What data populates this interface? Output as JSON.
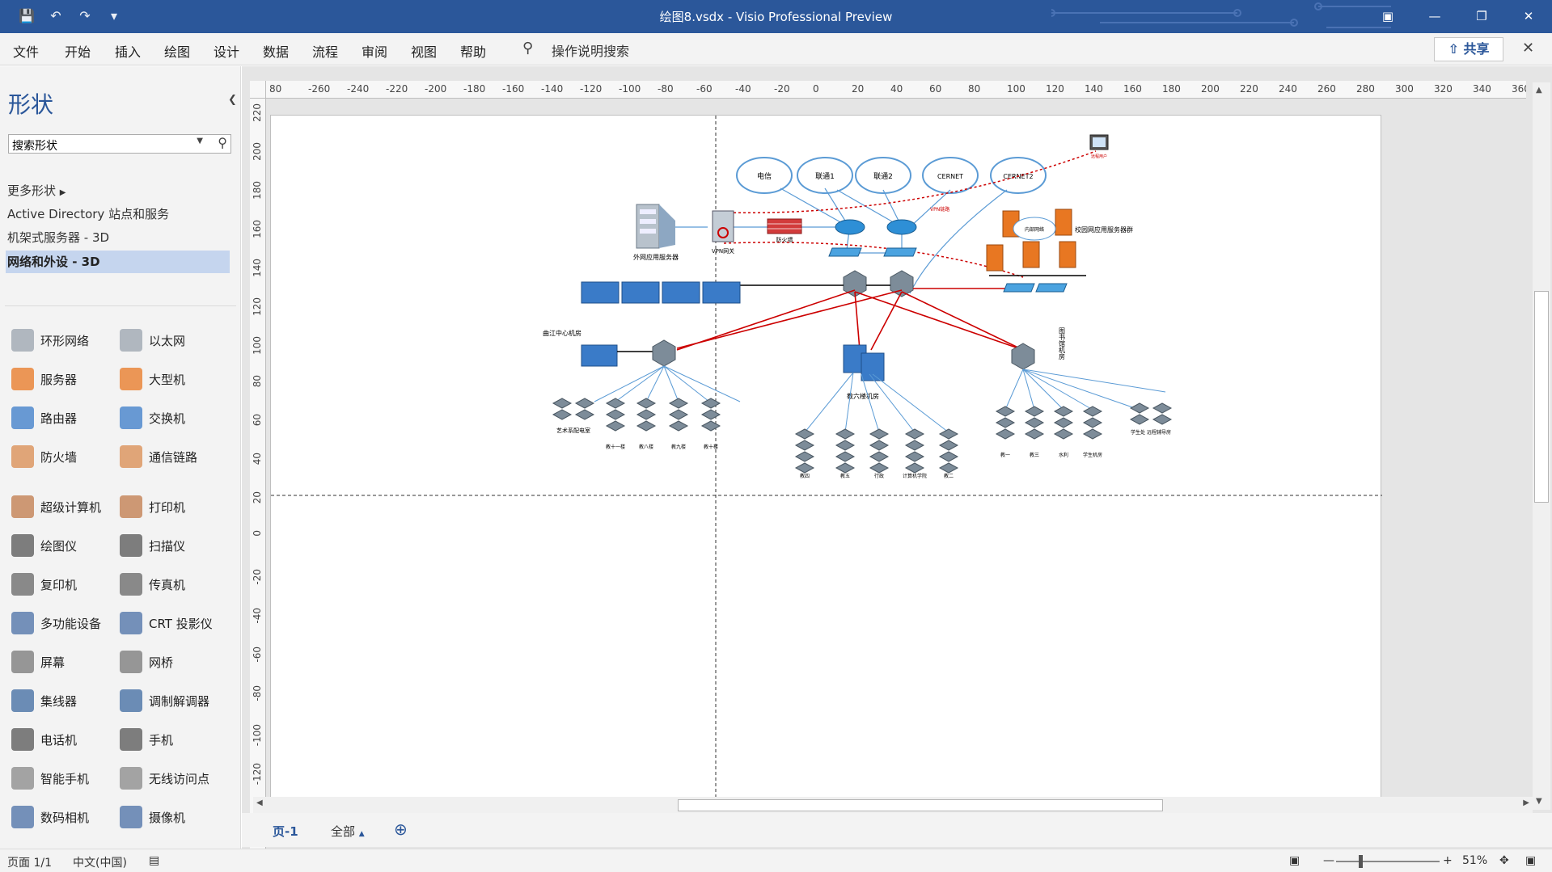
{
  "window": {
    "title": "绘图8.vsdx  -  Visio Professional Preview",
    "buttons": [
      "minimize",
      "restore",
      "close"
    ]
  },
  "quick_access": [
    "save-icon",
    "undo-icon",
    "redo-icon",
    "customize-icon"
  ],
  "menu": {
    "items": [
      "文件",
      "开始",
      "插入",
      "绘图",
      "设计",
      "数据",
      "流程",
      "审阅",
      "视图",
      "帮助"
    ],
    "tell_me": "操作说明搜索",
    "share": "共享"
  },
  "shapes_panel": {
    "title": "形状",
    "search_placeholder": "搜索形状",
    "stencils": [
      "更多形状",
      "Active Directory 站点和服务",
      "机架式服务器 - 3D",
      "网络和外设 - 3D"
    ],
    "active_stencil": "网络和外设 - 3D",
    "shapes": [
      [
        "环形网络",
        "以太网"
      ],
      [
        "服务器",
        "大型机"
      ],
      [
        "路由器",
        "交换机"
      ],
      [
        "防火墙",
        "通信链路"
      ],
      [
        "超级计算机",
        "打印机"
      ],
      [
        "绘图仪",
        "扫描仪"
      ],
      [
        "复印机",
        "传真机"
      ],
      [
        "多功能设备",
        "CRT 投影仪"
      ],
      [
        "屏幕",
        "网桥"
      ],
      [
        "集线器",
        "调制解调器"
      ],
      [
        "电话机",
        "手机"
      ],
      [
        "智能手机",
        "无线访问点"
      ],
      [
        "数码相机",
        "摄像机"
      ]
    ]
  },
  "rulers": {
    "top": [
      "80",
      "-260",
      "-240",
      "-220",
      "-200",
      "-180",
      "-160",
      "-140",
      "-120",
      "-100",
      "-80",
      "-60",
      "-40",
      "-20",
      "0",
      "20",
      "40",
      "60",
      "80",
      "100",
      "120",
      "140",
      "160",
      "180",
      "200",
      "220",
      "240",
      "260",
      "280",
      "300",
      "320",
      "340",
      "360"
    ],
    "left": [
      "220",
      "200",
      "180",
      "160",
      "140",
      "120",
      "100",
      "80",
      "60",
      "40",
      "20",
      "0",
      "-20",
      "-40",
      "-60",
      "-80",
      "-100",
      "-120"
    ]
  },
  "diagram": {
    "clouds": [
      "电信",
      "联通1",
      "联通2",
      "CERNET",
      "CERNET2"
    ],
    "labels": {
      "external_server": "外网应用服务器",
      "vpn_gateway": "VPN网关",
      "firewall": "防火墙",
      "vpn_link": "VPN链路",
      "campus_servers": "校园网应用服务器群",
      "internal_net": "内部网络",
      "qujiang_room": "曲江中心机房",
      "library_room": "图书馆机房",
      "jiaoliu_room": "教六楼机房",
      "art_room": "艺术系配电室",
      "remote_user": "远程用户",
      "student_area": "学生处 远程辅导房"
    },
    "bottom_left": [
      "教十一楼",
      "教八楼",
      "教九楼",
      "教十楼"
    ],
    "bottom_mid": [
      "教四",
      "教五",
      "行政",
      "计算机学院",
      "教二"
    ],
    "bottom_right": [
      "教一",
      "教三",
      "水利",
      "学生机房"
    ]
  },
  "sheets": {
    "active": "页-1",
    "all": "全部"
  },
  "status": {
    "page": "页面 1/1",
    "language": "中文(中国)",
    "zoom": "51%"
  },
  "colors": {
    "titlebar": "#2b579a",
    "accent": "#2b579a",
    "red_link": "#cc0000",
    "blue_link": "#5b9bd5"
  }
}
